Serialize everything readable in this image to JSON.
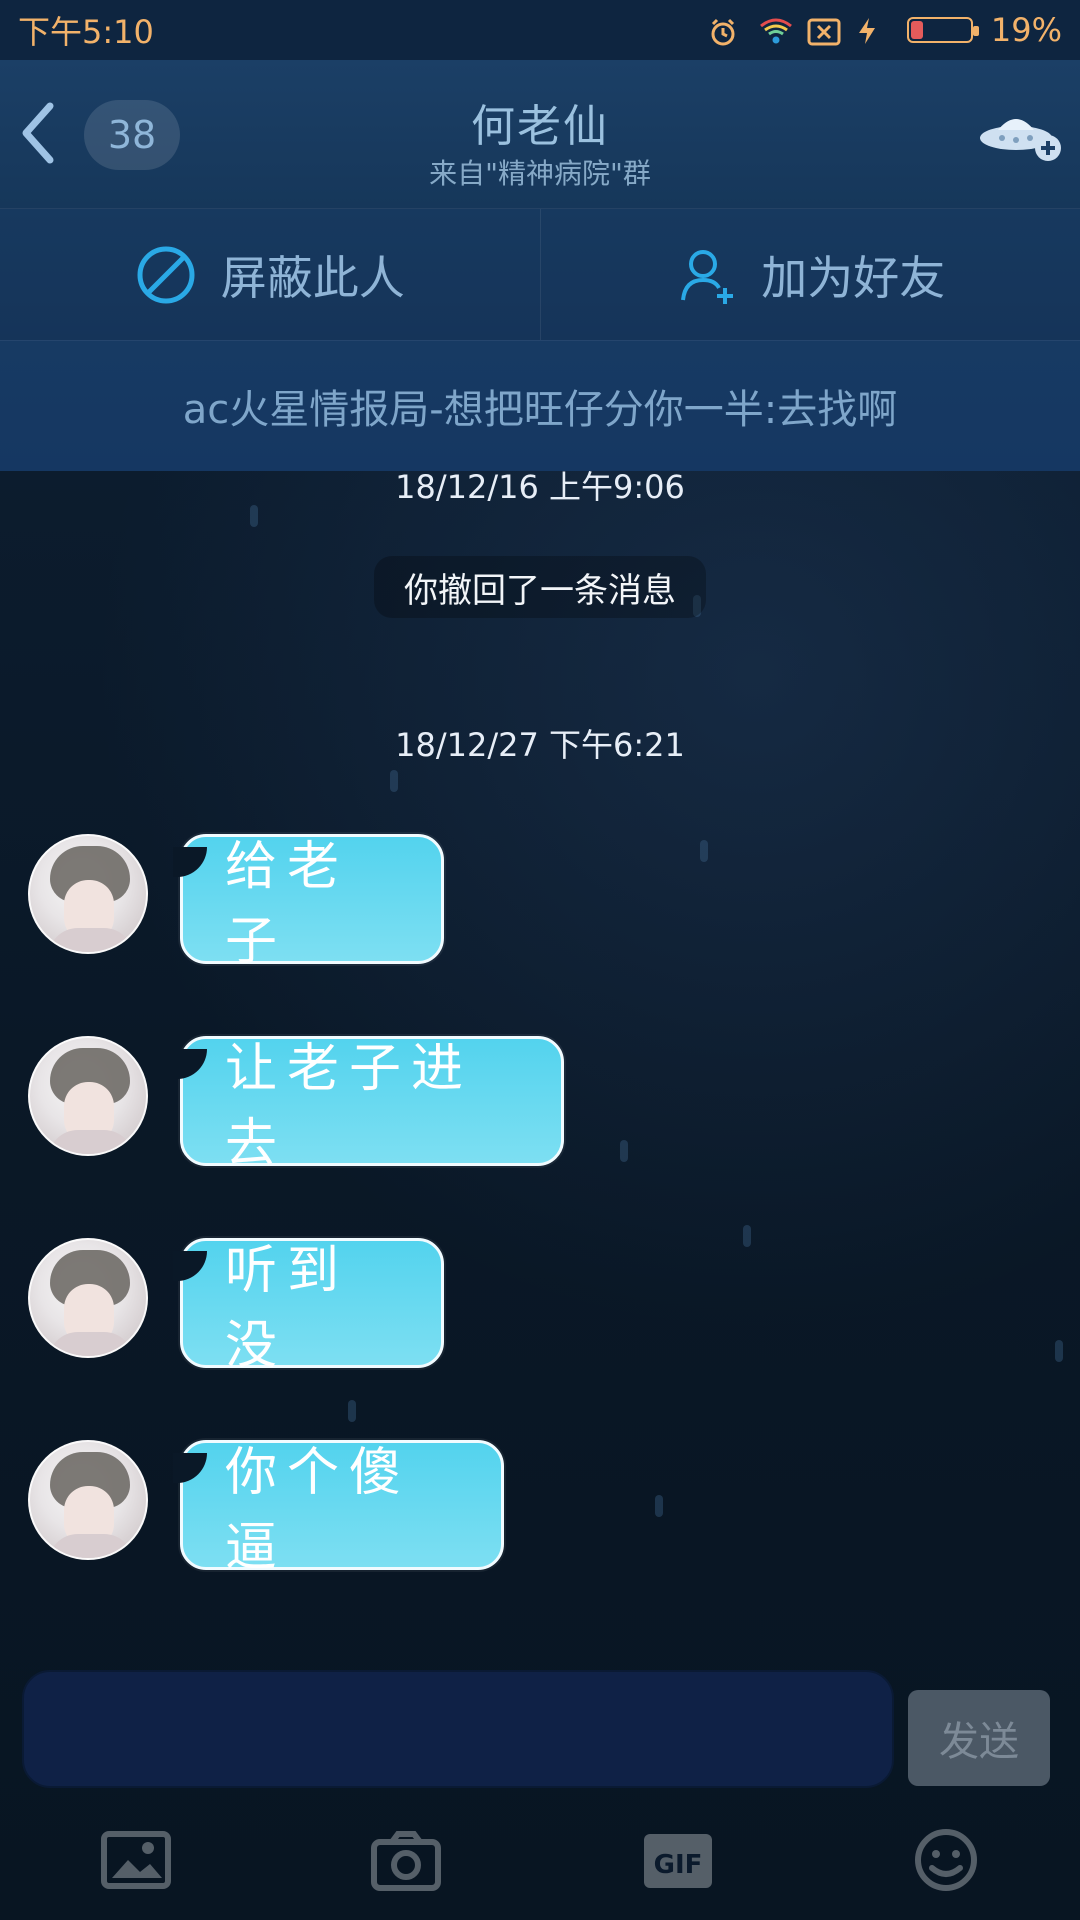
{
  "status_bar": {
    "time": "下午5:10",
    "battery": "19%",
    "battery_level": 0.19
  },
  "header": {
    "back_icon": "chevron-left-icon",
    "unread_count": "38",
    "title": "何老仙",
    "subtitle": "来自\"精神病院\"群",
    "add_icon": "ufo-add-icon"
  },
  "actions": {
    "block_label": "屏蔽此人",
    "add_friend_label": "加为好友"
  },
  "notice": {
    "text": "ac火星情报局-想把旺仔分你一半:去找啊"
  },
  "chat": {
    "timestamp_1": "18/12/16 上午9:06",
    "recall_text": "你撤回了一条消息",
    "timestamp_2": "18/12/27 下午6:21",
    "messages": [
      {
        "text": "给老子"
      },
      {
        "text": "让老子进去"
      },
      {
        "text": "听到没"
      },
      {
        "text": "你个傻逼"
      }
    ]
  },
  "composer": {
    "input_value": "",
    "send_label": "发送"
  },
  "toolbar": {
    "items": [
      "image-icon",
      "camera-icon",
      "gif-icon",
      "emoji-icon"
    ],
    "gif_label": "GIF"
  },
  "colors": {
    "bubble": "#53d3ee",
    "status": "#f2b26a",
    "header": "#1b3f66"
  }
}
